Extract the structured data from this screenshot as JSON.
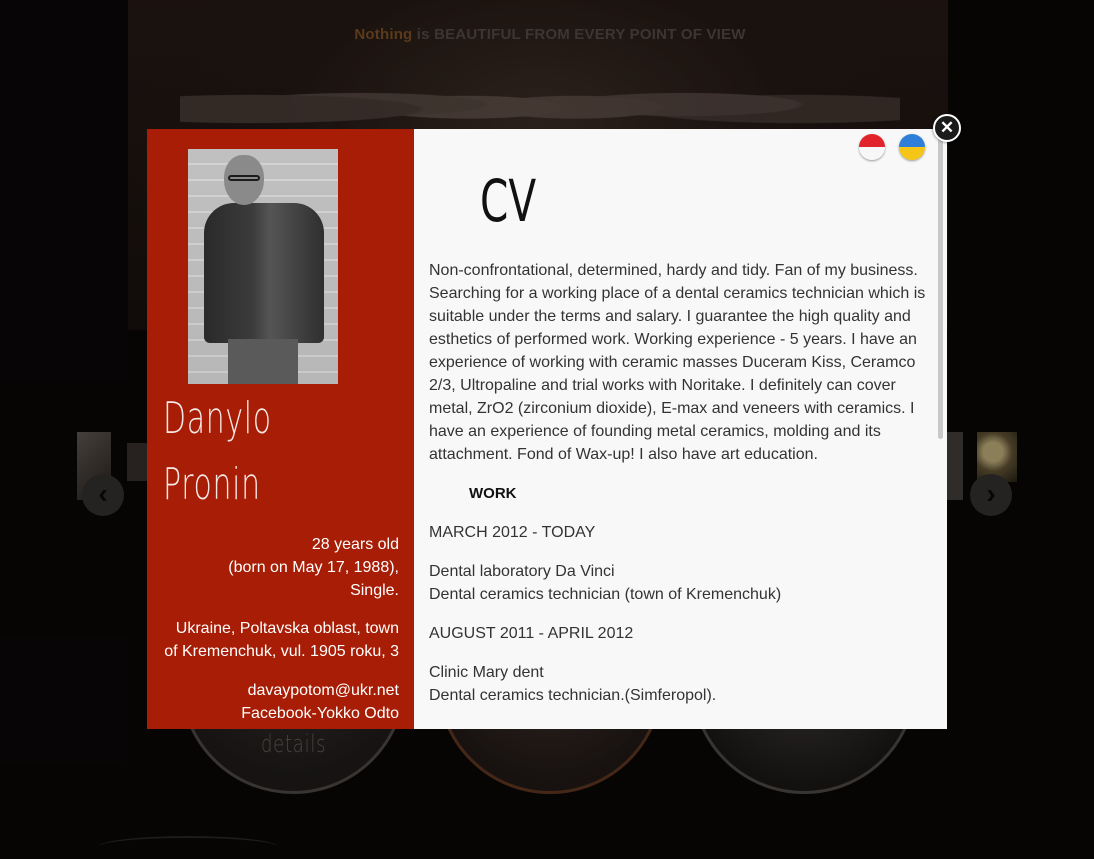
{
  "background": {
    "tagline_highlight": "Nothing",
    "tagline_rest": "is BEAUTIFUL FROM EVERY POINT OF VIEW",
    "details_label": "details"
  },
  "navigation": {
    "prev_icon": "chevron-left",
    "next_icon": "chevron-right",
    "prev_glyph": "‹",
    "next_glyph": "›"
  },
  "modal": {
    "close_glyph": "✕",
    "languages": [
      "Indonesian flag",
      "Ukrainian flag"
    ],
    "profile": {
      "first_name": "Danylo",
      "last_name": "Pronin",
      "age": "28 years old",
      "born": "(born on May 17, 1988),",
      "status": "Single.",
      "address_line1": "Ukraine, Poltavska oblast, town",
      "address_line2": "of Kremenchuk, vul. 1905 roku, 3",
      "email": "davaypotom@ukr.net",
      "facebook": "Facebook-Yokko Odto"
    },
    "cv": {
      "title": "CV",
      "summary": "Non-confrontational, determined, hardy and tidy. Fan of my business. Searching for a working place of a dental ceramics technician which is suitable under the terms and salary. I guarantee the high quality and esthetics of performed work. Working experience - 5 years. I have an experience of working with ceramic masses Duceram Kiss, Ceramco 2/3, Ultropaline and trial works with Noritake. I definitely can cover metal, ZrO2 (zirconium dioxide), E-max and veneers with ceramics. I have an experience of founding metal ceramics, molding and its attachment. Fond of Wax-up! I also have art education.",
      "work_heading": "WORK",
      "jobs": [
        {
          "period": "MARCH 2012 - TODAY",
          "employer": "Dental laboratory Da Vinci",
          "role": "Dental ceramics technician (town of Kremenchuk)"
        },
        {
          "period": "AUGUST 2011 - APRIL 2012",
          "employer": "Clinic Mary dent",
          "role": "Dental ceramics technician.(Simferopol)."
        }
      ]
    }
  },
  "colors": {
    "sidebar": "#a71d05",
    "content_bg": "#f8f8f8",
    "tagline_highlight": "#8a5a2a"
  }
}
